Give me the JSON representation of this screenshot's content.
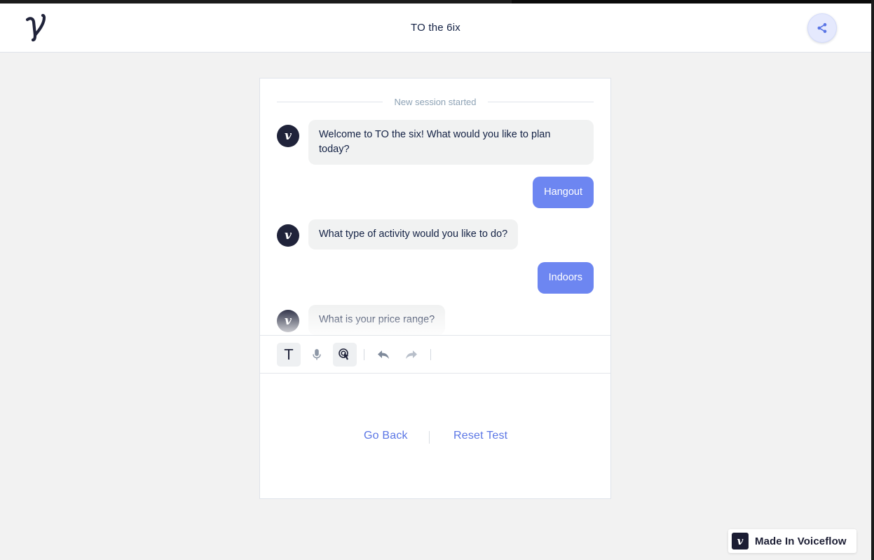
{
  "app": {
    "title": "TO the 6ix"
  },
  "session": {
    "divider_text": "New session started"
  },
  "messages": [
    {
      "from": "bot",
      "text": "Welcome to TO the six! What would you like to plan today?"
    },
    {
      "from": "user",
      "text": "Hangout"
    },
    {
      "from": "bot",
      "text": "What type of activity would you like to do?"
    },
    {
      "from": "user",
      "text": "Indoors"
    },
    {
      "from": "bot",
      "text": "What is your price range?"
    }
  ],
  "toolbar": {
    "text_mode_icon": "text-icon",
    "voice_icon": "microphone-icon",
    "debug_icon": "touch-hand-icon",
    "undo_icon": "undo-icon",
    "redo_icon": "redo-icon"
  },
  "actions": {
    "go_back": "Go Back",
    "reset_test": "Reset Test"
  },
  "branding": {
    "made_in": "Made In Voiceflow"
  },
  "colors": {
    "accent": "#6d86f1",
    "link": "#5b76e5",
    "avatar": "#20233a",
    "bot_bubble": "#f1f2f2"
  }
}
